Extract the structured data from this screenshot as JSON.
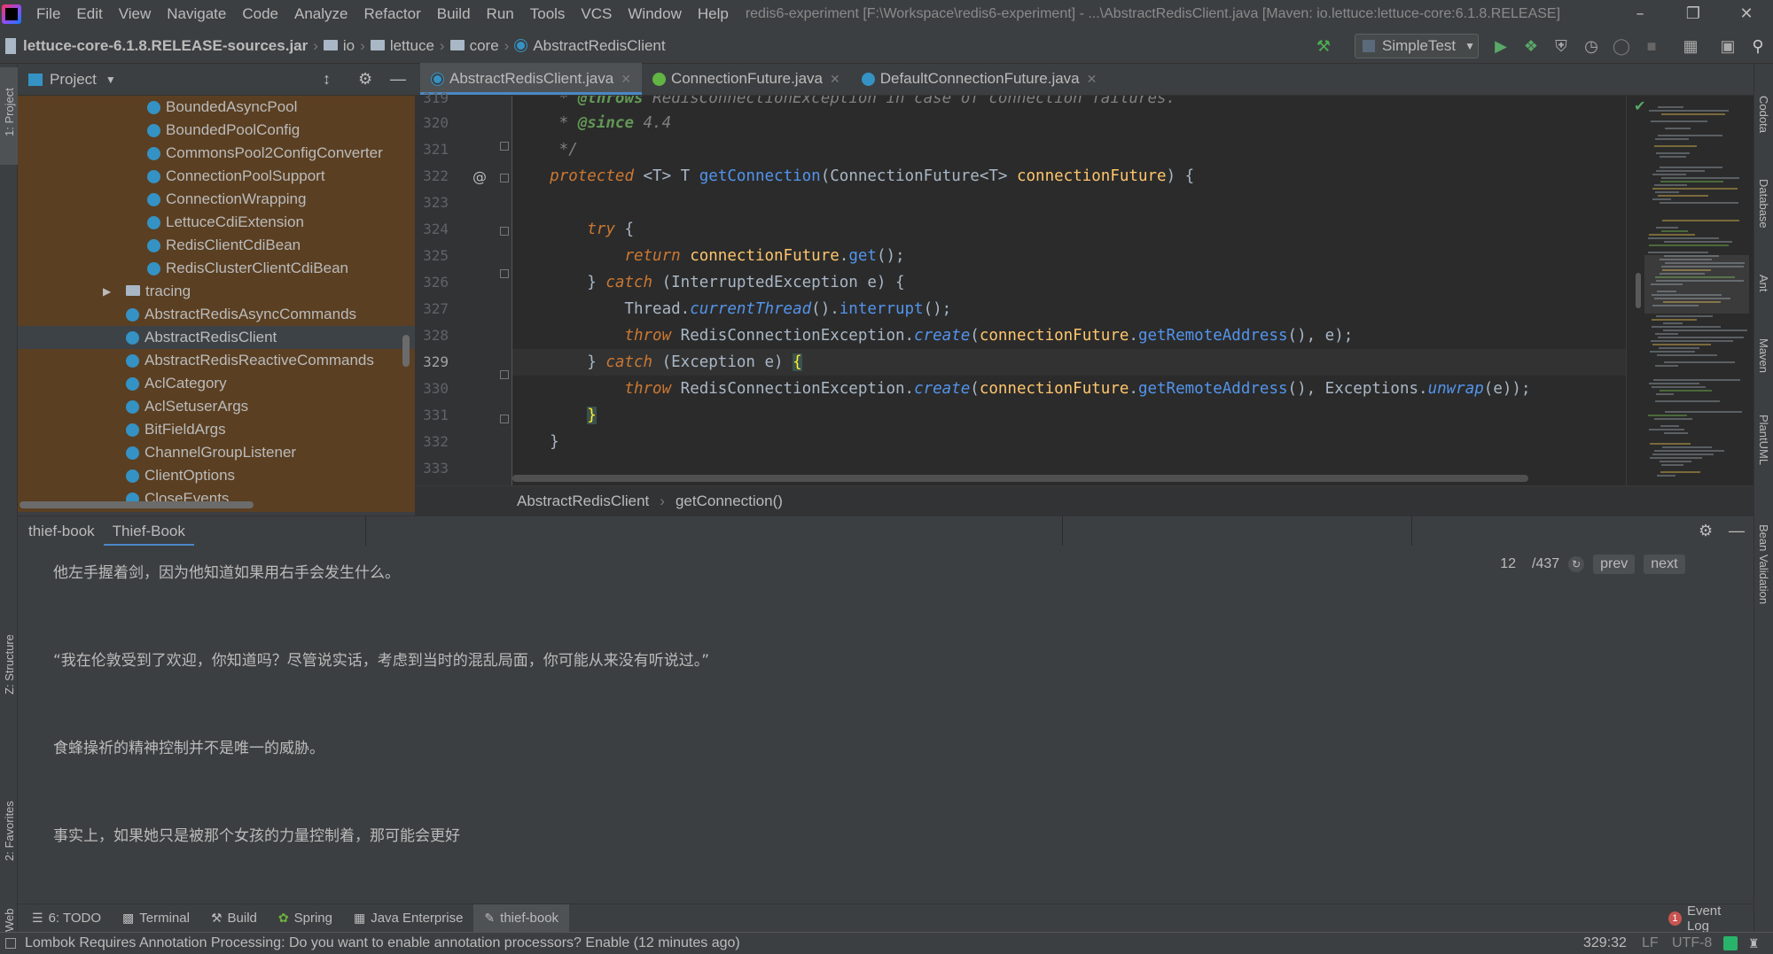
{
  "menu": {
    "items": [
      "File",
      "Edit",
      "View",
      "Navigate",
      "Code",
      "Analyze",
      "Refactor",
      "Build",
      "Run",
      "Tools",
      "VCS",
      "Window",
      "Help"
    ],
    "window_title": "redis6-experiment [F:\\Workspace\\redis6-experiment] - ...\\AbstractRedisClient.java [Maven: io.lettuce:lettuce-core:6.1.8.RELEASE]"
  },
  "navbar": {
    "jar": "lettuce-core-6.1.8.RELEASE-sources.jar",
    "crumbs": [
      "io",
      "lettuce",
      "core"
    ],
    "class": "AbstractRedisClient",
    "run_config": "SimpleTest"
  },
  "left_strip": {
    "project": "1: Project",
    "structure": "Z: Structure",
    "favorites": "2: Favorites",
    "web": "Web"
  },
  "right_strip": [
    "Codota",
    "Database",
    "Ant",
    "Maven",
    "PlantUML",
    "Bean Validation"
  ],
  "project_panel": {
    "title": "Project",
    "items": [
      {
        "label": "BoundedAsyncPool",
        "indent": 2,
        "kind": "class"
      },
      {
        "label": "BoundedPoolConfig",
        "indent": 2,
        "kind": "class"
      },
      {
        "label": "CommonsPool2ConfigConverter",
        "indent": 2,
        "kind": "class"
      },
      {
        "label": "ConnectionPoolSupport",
        "indent": 2,
        "kind": "class"
      },
      {
        "label": "ConnectionWrapping",
        "indent": 2,
        "kind": "class"
      },
      {
        "label": "LettuceCdiExtension",
        "indent": 2,
        "kind": "class"
      },
      {
        "label": "RedisClientCdiBean",
        "indent": 2,
        "kind": "class"
      },
      {
        "label": "RedisClusterClientCdiBean",
        "indent": 2,
        "kind": "class"
      },
      {
        "label": "tracing",
        "indent": 1,
        "kind": "folder"
      },
      {
        "label": "AbstractRedisAsyncCommands",
        "indent": 1,
        "kind": "class"
      },
      {
        "label": "AbstractRedisClient",
        "indent": 1,
        "kind": "class",
        "selected": true
      },
      {
        "label": "AbstractRedisReactiveCommands",
        "indent": 1,
        "kind": "class"
      },
      {
        "label": "AclCategory",
        "indent": 1,
        "kind": "class"
      },
      {
        "label": "AclSetuserArgs",
        "indent": 1,
        "kind": "class"
      },
      {
        "label": "BitFieldArgs",
        "indent": 1,
        "kind": "class"
      },
      {
        "label": "ChannelGroupListener",
        "indent": 1,
        "kind": "class"
      },
      {
        "label": "ClientOptions",
        "indent": 1,
        "kind": "class"
      },
      {
        "label": "CloseEvents",
        "indent": 1,
        "kind": "class"
      }
    ]
  },
  "editor": {
    "tabs": [
      {
        "label": "AbstractRedisClient.java",
        "icon": "class-icon",
        "active": true
      },
      {
        "label": "ConnectionFuture.java",
        "icon": "interface-icon",
        "active": false
      },
      {
        "label": "DefaultConnectionFuture.java",
        "icon": "class-icon",
        "active": false
      }
    ],
    "line_numbers": [
      "319",
      "320",
      "321",
      "322",
      "323",
      "324",
      "325",
      "326",
      "327",
      "328",
      "329",
      "330",
      "331",
      "332",
      "333"
    ],
    "current_line": "329",
    "breadcrumb": [
      "AbstractRedisClient",
      "getConnection()"
    ]
  },
  "book": {
    "tabs": [
      "thief-book",
      "Thief-Book"
    ],
    "paragraphs": [
      "他左手握着剑，因为他知道如果用右手会发生什么。",
      "“我在伦敦受到了欢迎，你知道吗？尽管说实话，考虑到当时的混乱局面，你可能从来没有听说过。”",
      "食蜂操祈的精神控制并不是唯一的威胁。",
      "事实上，如果她只是被那个女孩的力量控制着，那可能会更好"
    ],
    "page": "12",
    "total": "/437",
    "prev": "prev",
    "next": "next"
  },
  "toolwindows": [
    {
      "label": "6: TODO",
      "icon": "todo-icon"
    },
    {
      "label": "Terminal",
      "icon": "terminal-icon"
    },
    {
      "label": "Build",
      "icon": "build-icon"
    },
    {
      "label": "Spring",
      "icon": "spring-icon"
    },
    {
      "label": "Java Enterprise",
      "icon": "java-enterprise-icon"
    },
    {
      "label": "thief-book",
      "icon": "thief-book-icon",
      "active": true
    }
  ],
  "event_log": {
    "count": "1",
    "label": "Event Log"
  },
  "status": {
    "message": "Lombok Requires Annotation Processing: Do you want to enable annotation processors? Enable (12 minutes ago)",
    "position": "329:32",
    "line_sep": "LF",
    "encoding": "UTF-8"
  },
  "colors": {
    "project_tree_bg": "#5a3f22",
    "editor_bg": "#2b2b2b",
    "accent": "#4a88c7",
    "keyword": "#cc7832",
    "method_decl": "#ffc66d"
  }
}
